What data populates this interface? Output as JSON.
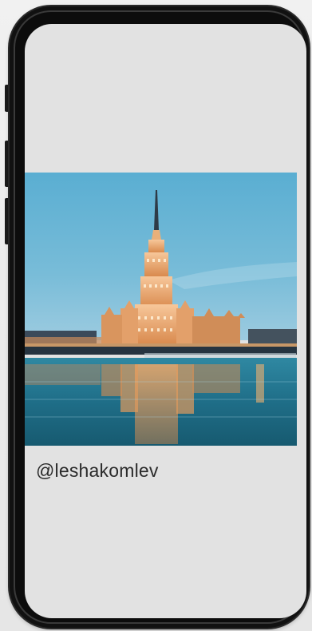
{
  "post": {
    "image_subject": "illuminated-skyscraper-reflection-photo",
    "caption": "@leshakomlev"
  },
  "colors": {
    "page_background": "#ececec",
    "screen_background": "#e2e2e2",
    "phone_frame": "#111111",
    "sky": "#6cb6d6",
    "water": "#1d6f8a",
    "building_light": "#f4b57a",
    "caption_text": "#2b2b2b"
  }
}
